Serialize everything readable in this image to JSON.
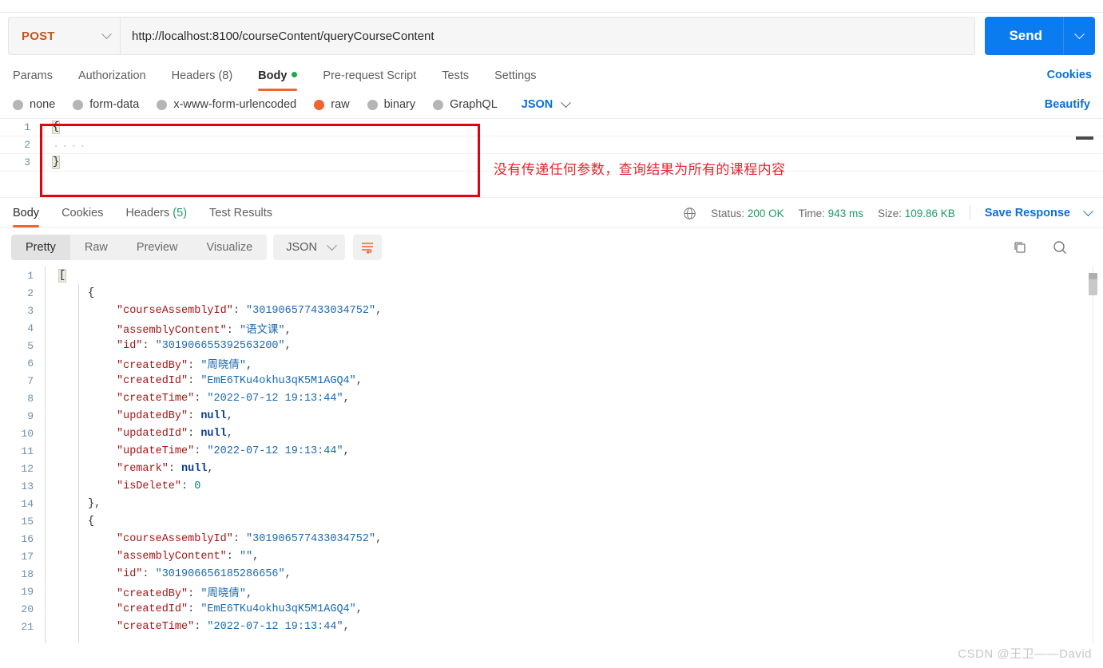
{
  "request": {
    "method": "POST",
    "url": "http://localhost:8100/courseContent/queryCourseContent",
    "send_label": "Send",
    "tabs": [
      {
        "label": "Params",
        "active": false
      },
      {
        "label": "Authorization",
        "active": false
      },
      {
        "label": "Headers (8)",
        "active": false
      },
      {
        "label": "Body",
        "active": true,
        "dot": true
      },
      {
        "label": "Pre-request Script",
        "active": false
      },
      {
        "label": "Tests",
        "active": false
      },
      {
        "label": "Settings",
        "active": false
      }
    ],
    "cookies_link": "Cookies",
    "beautify_link": "Beautify",
    "body_types": [
      {
        "label": "none",
        "selected": false
      },
      {
        "label": "form-data",
        "selected": false
      },
      {
        "label": "x-www-form-urlencoded",
        "selected": false
      },
      {
        "label": "raw",
        "selected": true
      },
      {
        "label": "binary",
        "selected": false
      },
      {
        "label": "GraphQL",
        "selected": false
      }
    ],
    "raw_format": "JSON",
    "body_lines": [
      {
        "num": "1",
        "text": "{"
      },
      {
        "num": "2",
        "text": "...."
      },
      {
        "num": "3",
        "text": "}"
      }
    ],
    "annotation": "没有传递任何参数，查询结果为所有的课程内容"
  },
  "response": {
    "tabs": [
      {
        "label": "Body",
        "active": true
      },
      {
        "label": "Cookies",
        "active": false
      },
      {
        "label": "Headers (5)",
        "active": false
      },
      {
        "label": "Test Results",
        "active": false
      }
    ],
    "status_label": "Status:",
    "status_value": "200 OK",
    "time_label": "Time:",
    "time_value": "943 ms",
    "size_label": "Size:",
    "size_value": "109.86 KB",
    "save_response": "Save Response",
    "view_modes": [
      {
        "label": "Pretty",
        "active": true
      },
      {
        "label": "Raw",
        "active": false
      },
      {
        "label": "Preview",
        "active": false
      },
      {
        "label": "Visualize",
        "active": false
      }
    ],
    "format": "JSON",
    "code_lines": [
      {
        "num": "1",
        "indent": 0,
        "html": "<span class=\"br hl-br\">[</span>"
      },
      {
        "num": "2",
        "indent": 1,
        "html": "<span class=\"br\">{</span>"
      },
      {
        "num": "3",
        "indent": 2,
        "html": "<span class=\"k\">\"courseAssemblyId\"</span><span class=\"p\">: </span><span class=\"s\">\"301906577433034752\"</span><span class=\"p\">,</span>"
      },
      {
        "num": "4",
        "indent": 2,
        "html": "<span class=\"k\">\"assemblyContent\"</span><span class=\"p\">: </span><span class=\"s\">\"语文课\"</span><span class=\"p\">,</span>"
      },
      {
        "num": "5",
        "indent": 2,
        "html": "<span class=\"k\">\"id\"</span><span class=\"p\">: </span><span class=\"s\">\"301906655392563200\"</span><span class=\"p\">,</span>"
      },
      {
        "num": "6",
        "indent": 2,
        "html": "<span class=\"k\">\"createdBy\"</span><span class=\"p\">: </span><span class=\"s\">\"周晓倩\"</span><span class=\"p\">,</span>"
      },
      {
        "num": "7",
        "indent": 2,
        "html": "<span class=\"k\">\"createdId\"</span><span class=\"p\">: </span><span class=\"s\">\"EmE6TKu4okhu3qK5M1AGQ4\"</span><span class=\"p\">,</span>"
      },
      {
        "num": "8",
        "indent": 2,
        "html": "<span class=\"k\">\"createTime\"</span><span class=\"p\">: </span><span class=\"s\">\"2022-07-12 19:13:44\"</span><span class=\"p\">,</span>"
      },
      {
        "num": "9",
        "indent": 2,
        "html": "<span class=\"k\">\"updatedBy\"</span><span class=\"p\">: </span><span class=\"nul\">null</span><span class=\"p\">,</span>"
      },
      {
        "num": "10",
        "indent": 2,
        "html": "<span class=\"k\">\"updatedId\"</span><span class=\"p\">: </span><span class=\"nul\">null</span><span class=\"p\">,</span>"
      },
      {
        "num": "11",
        "indent": 2,
        "html": "<span class=\"k\">\"updateTime\"</span><span class=\"p\">: </span><span class=\"s\">\"2022-07-12 19:13:44\"</span><span class=\"p\">,</span>"
      },
      {
        "num": "12",
        "indent": 2,
        "html": "<span class=\"k\">\"remark\"</span><span class=\"p\">: </span><span class=\"nul\">null</span><span class=\"p\">,</span>"
      },
      {
        "num": "13",
        "indent": 2,
        "html": "<span class=\"k\">\"isDelete\"</span><span class=\"p\">: </span><span class=\"n\">0</span>"
      },
      {
        "num": "14",
        "indent": 1,
        "html": "<span class=\"br\">}</span><span class=\"p\">,</span>"
      },
      {
        "num": "15",
        "indent": 1,
        "html": "<span class=\"br\">{</span>"
      },
      {
        "num": "16",
        "indent": 2,
        "html": "<span class=\"k\">\"courseAssemblyId\"</span><span class=\"p\">: </span><span class=\"s\">\"301906577433034752\"</span><span class=\"p\">,</span>"
      },
      {
        "num": "17",
        "indent": 2,
        "html": "<span class=\"k\">\"assemblyContent\"</span><span class=\"p\">: </span><span class=\"s\">\"\"</span><span class=\"p\">,</span>"
      },
      {
        "num": "18",
        "indent": 2,
        "html": "<span class=\"k\">\"id\"</span><span class=\"p\">: </span><span class=\"s\">\"301906656185286656\"</span><span class=\"p\">,</span>"
      },
      {
        "num": "19",
        "indent": 2,
        "html": "<span class=\"k\">\"createdBy\"</span><span class=\"p\">: </span><span class=\"s\">\"周晓倩\"</span><span class=\"p\">,</span>"
      },
      {
        "num": "20",
        "indent": 2,
        "html": "<span class=\"k\">\"createdId\"</span><span class=\"p\">: </span><span class=\"s\">\"EmE6TKu4okhu3qK5M1AGQ4\"</span><span class=\"p\">,</span>"
      },
      {
        "num": "21",
        "indent": 2,
        "html": "<span class=\"k\">\"createTime\"</span><span class=\"p\">: </span><span class=\"s\">\"2022-07-12 19:13:44\"</span><span class=\"p\">,</span>"
      }
    ]
  },
  "watermark": "CSDN @王卫——David",
  "colors": {
    "accent_orange": "#ef6430",
    "link_blue": "#0a6fd8",
    "send_blue": "#0a7cf0",
    "method_orange": "#c0581b",
    "status_green": "#1d9d62",
    "annotation_red": "#e3262f",
    "box_red": "#e3000f"
  }
}
